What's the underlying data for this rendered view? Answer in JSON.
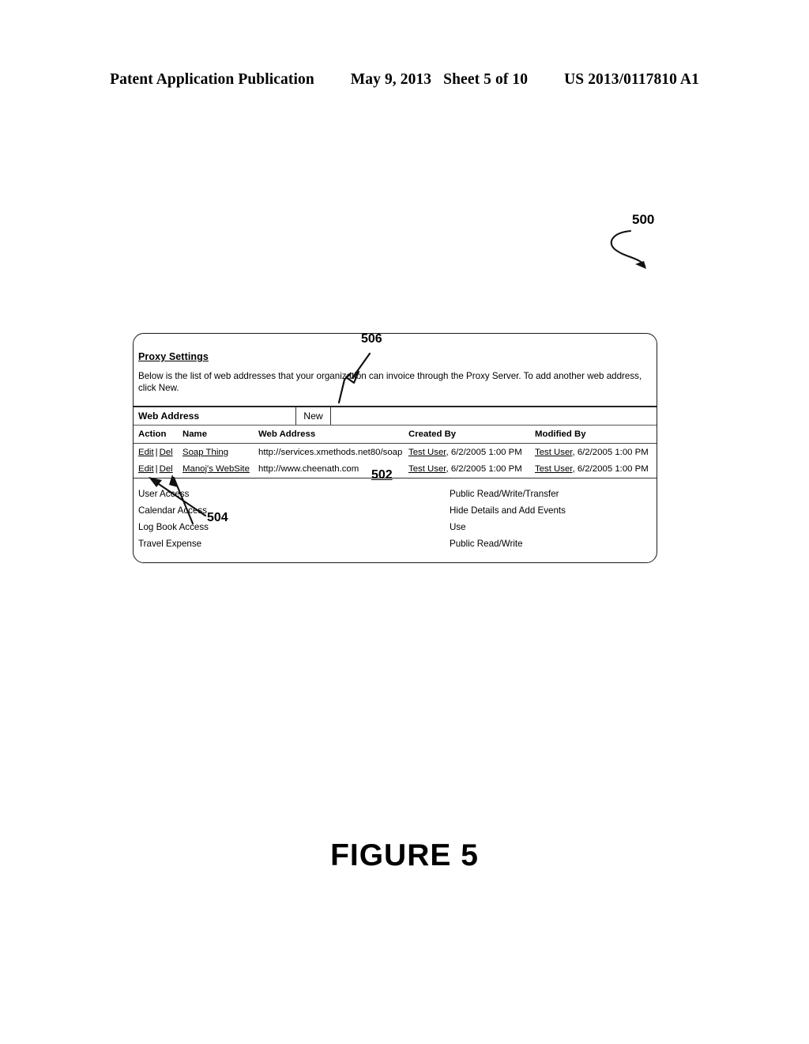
{
  "page": {
    "header": {
      "publication": "Patent Application Publication",
      "date": "May 9, 2013",
      "sheet": "Sheet 5 of 10",
      "patent_number": "US 2013/0117810 A1"
    },
    "figure_caption": "FIGURE 5"
  },
  "reference_numerals": {
    "screen": "500",
    "grid": "502",
    "action_links": "504",
    "new_button": "506"
  },
  "dialog": {
    "title": "Proxy Settings",
    "description": "Below is the list of web addresses that your organization can invoice through the Proxy Server.  To add another web address, click New.",
    "toolbar": {
      "label": "Web Address",
      "new_label": "New"
    },
    "grid": {
      "columns": [
        "Action",
        "Name",
        "Web Address",
        "Created By",
        "Modified By"
      ],
      "rows": [
        {
          "edit_label": "Edit",
          "separator": "|",
          "delete_label": "Del",
          "name": "Soap Thing",
          "web_address": "http://services.xmethods.net80/soap",
          "created_by_user": "Test User,",
          "created_by_date": "6/2/2005  1:00 PM",
          "modified_by_user": "Test User,",
          "modified_by_date": "6/2/2005  1:00 PM"
        },
        {
          "edit_label": "Edit",
          "separator": "|",
          "delete_label": "Del",
          "name": "Manoj's WebSite",
          "web_address": "http://www.cheenath.com",
          "created_by_user": "Test User,",
          "created_by_date": "6/2/2005  1:00 PM",
          "modified_by_user": "Test User,",
          "modified_by_date": "6/2/2005  1:00 PM"
        }
      ]
    },
    "permissions": [
      {
        "name": "User Access",
        "value": "Public Read/Write/Transfer"
      },
      {
        "name": "Calendar Access",
        "value": "Hide Details and Add Events"
      },
      {
        "name": "Log Book Access",
        "value": "Use"
      },
      {
        "name": "Travel Expense",
        "value": "Public Read/Write"
      }
    ]
  },
  "colors": {
    "ink": "#000000",
    "paper": "#ffffff"
  }
}
